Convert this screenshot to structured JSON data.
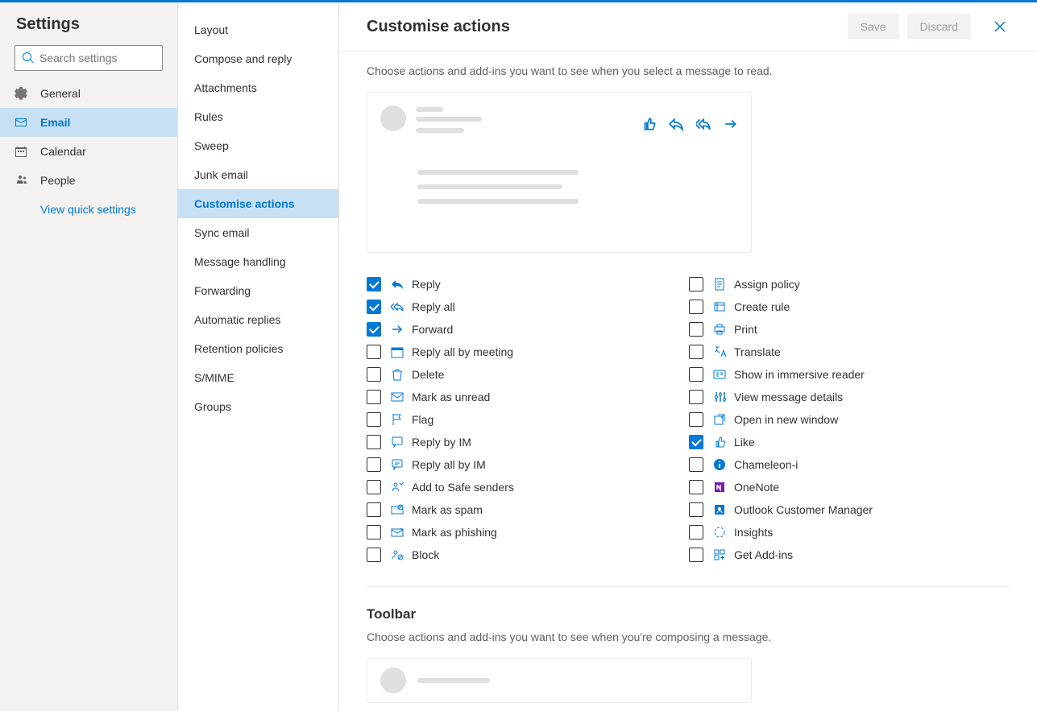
{
  "sidebar": {
    "title": "Settings",
    "search_placeholder": "Search settings",
    "items": [
      {
        "label": "General"
      },
      {
        "label": "Email"
      },
      {
        "label": "Calendar"
      },
      {
        "label": "People"
      }
    ],
    "quick_link": "View quick settings"
  },
  "subnav": {
    "items": [
      "Layout",
      "Compose and reply",
      "Attachments",
      "Rules",
      "Sweep",
      "Junk email",
      "Customise actions",
      "Sync email",
      "Message handling",
      "Forwarding",
      "Automatic replies",
      "Retention policies",
      "S/MIME",
      "Groups"
    ],
    "active": "Customise actions"
  },
  "header": {
    "title": "Customise actions",
    "save": "Save",
    "discard": "Discard"
  },
  "message_surface": {
    "description": "Choose actions and add-ins you want to see when you select a message to read.",
    "options_left": [
      {
        "label": "Reply",
        "checked": true,
        "icon": "reply"
      },
      {
        "label": "Reply all",
        "checked": true,
        "icon": "reply-all"
      },
      {
        "label": "Forward",
        "checked": true,
        "icon": "forward"
      },
      {
        "label": "Reply all by meeting",
        "checked": false,
        "icon": "calendar"
      },
      {
        "label": "Delete",
        "checked": false,
        "icon": "delete"
      },
      {
        "label": "Mark as unread",
        "checked": false,
        "icon": "mail"
      },
      {
        "label": "Flag",
        "checked": false,
        "icon": "flag"
      },
      {
        "label": "Reply by IM",
        "checked": false,
        "icon": "im"
      },
      {
        "label": "Reply all by IM",
        "checked": false,
        "icon": "im-all"
      },
      {
        "label": "Add to Safe senders",
        "checked": false,
        "icon": "safe"
      },
      {
        "label": "Mark as spam",
        "checked": false,
        "icon": "spam"
      },
      {
        "label": "Mark as phishing",
        "checked": false,
        "icon": "phishing"
      },
      {
        "label": "Block",
        "checked": false,
        "icon": "block"
      }
    ],
    "options_right": [
      {
        "label": "Assign policy",
        "checked": false,
        "icon": "policy"
      },
      {
        "label": "Create rule",
        "checked": false,
        "icon": "rule"
      },
      {
        "label": "Print",
        "checked": false,
        "icon": "print"
      },
      {
        "label": "Translate",
        "checked": false,
        "icon": "translate"
      },
      {
        "label": "Show in immersive reader",
        "checked": false,
        "icon": "reader"
      },
      {
        "label": "View message details",
        "checked": false,
        "icon": "details"
      },
      {
        "label": "Open in new window",
        "checked": false,
        "icon": "window"
      },
      {
        "label": "Like",
        "checked": true,
        "icon": "like"
      },
      {
        "label": "Chameleon-i",
        "checked": false,
        "icon": "info"
      },
      {
        "label": "OneNote",
        "checked": false,
        "icon": "onenote"
      },
      {
        "label": "Outlook Customer Manager",
        "checked": false,
        "icon": "ocm"
      },
      {
        "label": "Insights",
        "checked": false,
        "icon": "insights"
      },
      {
        "label": "Get Add-ins",
        "checked": false,
        "icon": "addins"
      }
    ]
  },
  "toolbar_section": {
    "title": "Toolbar",
    "description": "Choose actions and add-ins you want to see when you're composing a message."
  }
}
